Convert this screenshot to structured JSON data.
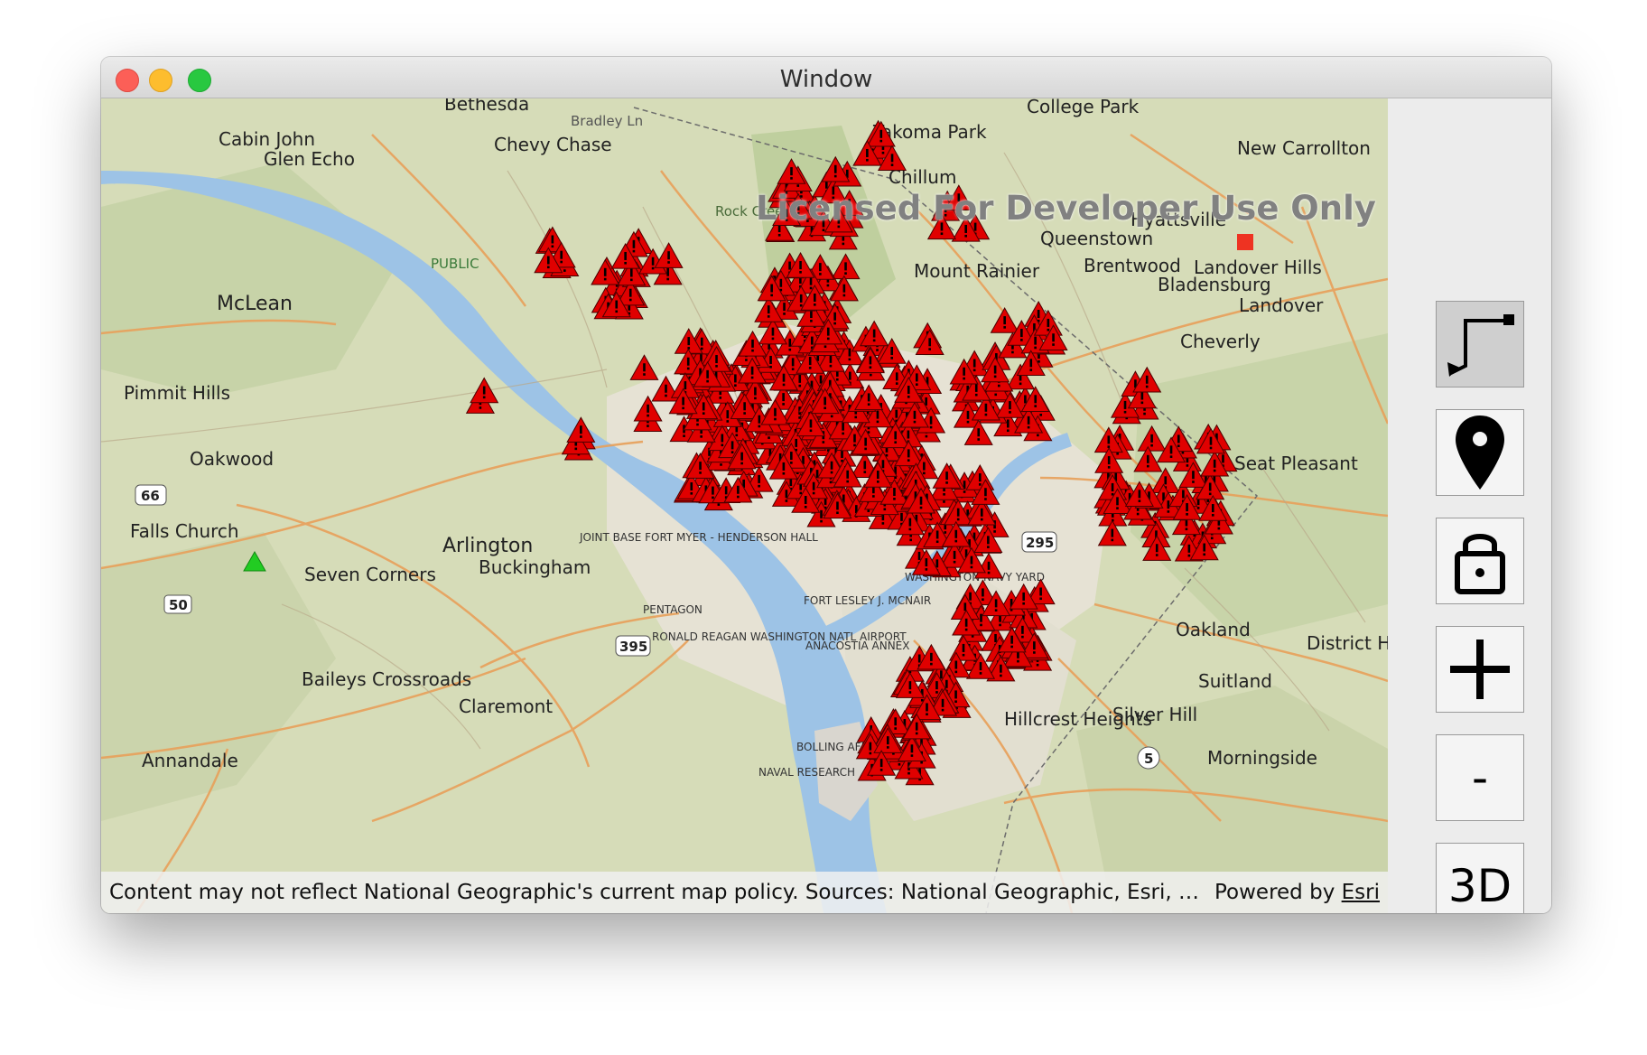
{
  "window": {
    "title": "Window"
  },
  "map": {
    "watermark": "Licensed For Developer Use Only",
    "labels": [
      "Bethesda",
      "Bradley Ln",
      "Chevy Chase",
      "Cabin John",
      "Glen Echo",
      "McLean",
      "Pimmit Hills",
      "Oakwood",
      "Falls Church",
      "Seven Corners",
      "Arlington",
      "Buckingham",
      "Baileys Crossroads",
      "Claremont",
      "Annandale",
      "Takoma Park",
      "College Park",
      "Chillum",
      "Hyattsville",
      "Queenstown",
      "Brentwood",
      "Mount Rainier",
      "Landover Hills",
      "Bladensburg",
      "Landover",
      "Cheverly",
      "Seat Pleasant",
      "Oakland",
      "District Heights",
      "Suitland",
      "Silver Hill",
      "Hillcrest Heights",
      "Morningside",
      "New Carrollton",
      "Rock Creek Park",
      "PUBLIC",
      "RONALD REAGAN WASHINGTON NATL AIRPORT",
      "ANACOSTIA ANNEX",
      "FORT LESLEY J. MCNAIR",
      "WASHINGTON NAVY YARD",
      "JOINT BASE FORT MYER - HENDERSON HALL",
      "PENTAGON",
      "BOLLING AFB",
      "NAVAL RESEARCH",
      "66",
      "50",
      "395",
      "295",
      "5"
    ],
    "incident_marker_color": "#e00000",
    "green_marker_color": "#22cc22",
    "red_square_color": "#ee3322"
  },
  "attribution": {
    "text": "Content may not reflect National Geographic's current map policy. Sources: National Geographic, Esri, DeLor…",
    "powered_by": "Powered by",
    "esri_link": "Esri"
  },
  "toolbar": {
    "route_tool": "route-icon",
    "pin_tool": "map-pin-icon",
    "lock_tool": "lock-icon",
    "zoom_in": "plus-icon",
    "zoom_out_label": "-",
    "view_3d_label": "3D"
  }
}
